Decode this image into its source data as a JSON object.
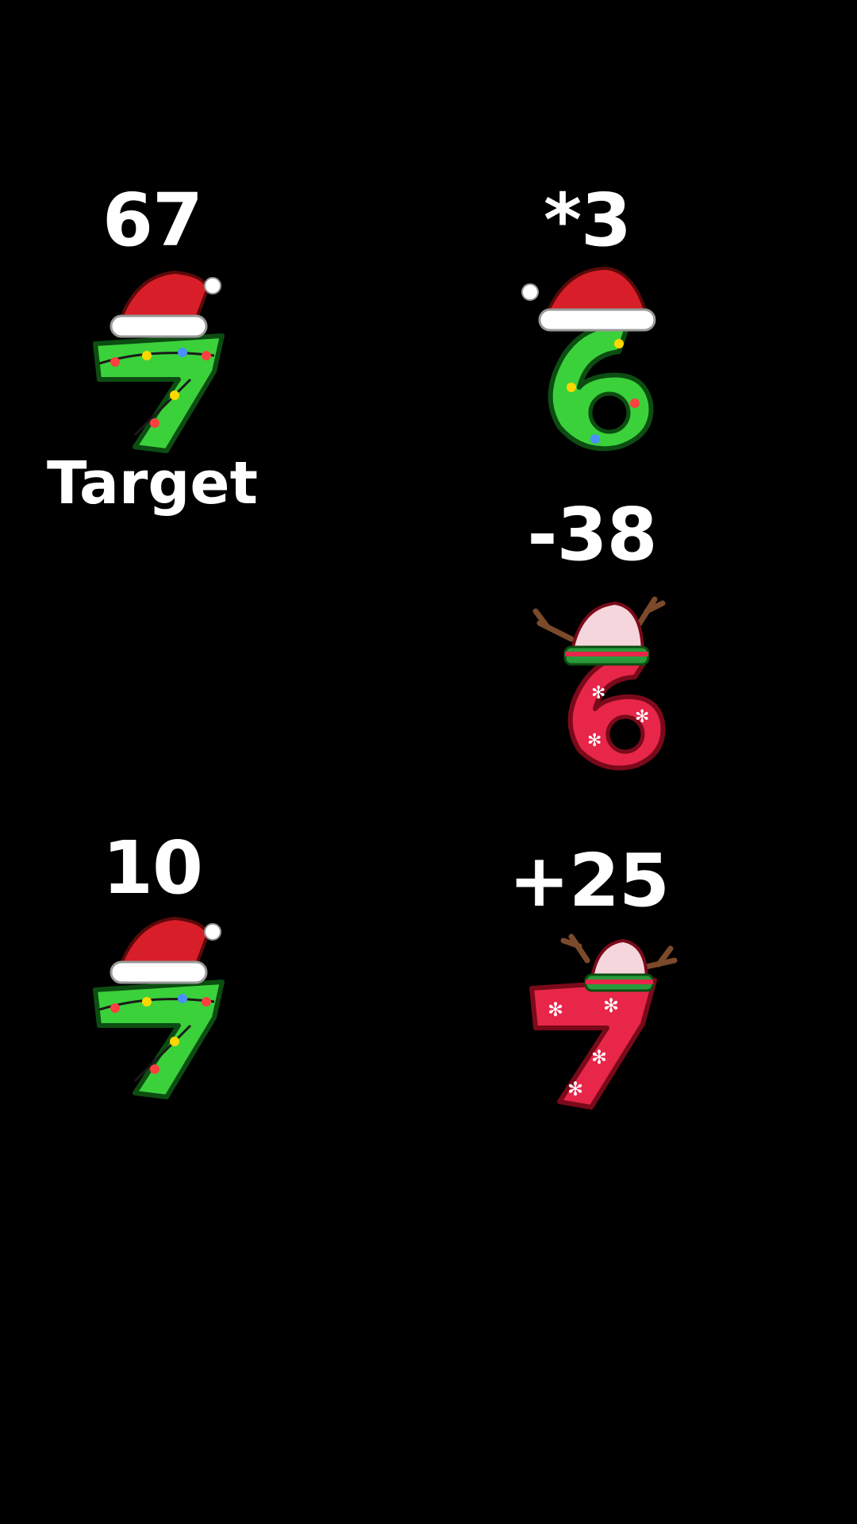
{
  "game": {
    "target": {
      "value": "67",
      "caption": "Target",
      "digit_style": "green-santa-hat-seven"
    },
    "operations": [
      {
        "label": "*3",
        "digit_style": "green-santa-hat-six"
      },
      {
        "label": "-38",
        "digit_style": "red-reindeer-six"
      },
      {
        "label": "+25",
        "digit_style": "red-reindeer-seven"
      }
    ],
    "start": {
      "value": "10",
      "digit_style": "green-santa-hat-seven"
    }
  },
  "colors": {
    "background": "#000000",
    "text": "#ffffff",
    "green_digit": "#2ecc40",
    "red_digit": "#e8264a",
    "santa_hat": "#d81e28"
  }
}
